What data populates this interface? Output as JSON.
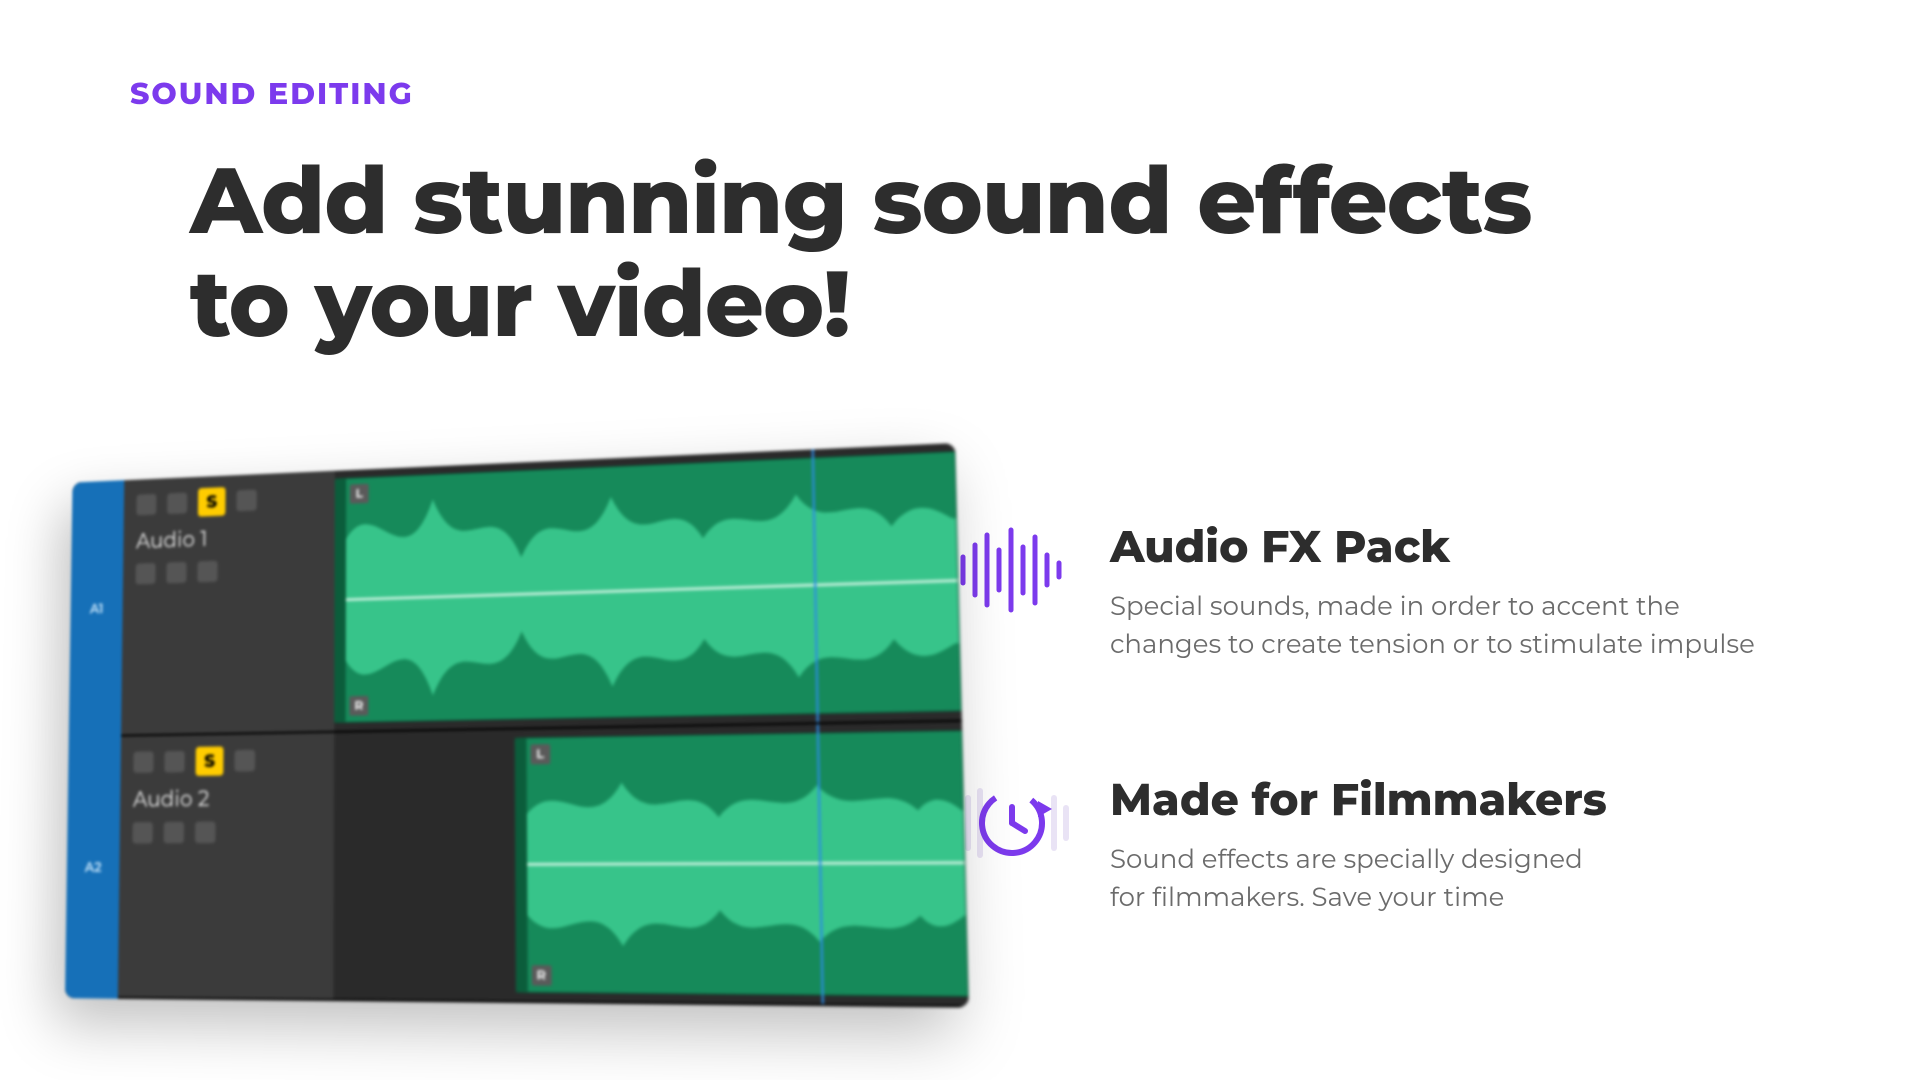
{
  "eyebrow": "SOUND EDITING",
  "headline": "Add stunning sound effects\nto your video!",
  "features": [
    {
      "icon": "waveform-icon",
      "title": "Audio FX Pack",
      "desc": "Special sounds, made in order to accent the\nchanges to create tension or to stimulate impulse"
    },
    {
      "icon": "clock-refresh-icon",
      "title": "Made for Filmmakers",
      "desc": "Sound effects are specially designed\nfor filmmakers. Save your time"
    }
  ],
  "screenshot": {
    "sidebar_labels": [
      "A1",
      "A2"
    ],
    "tracks": [
      {
        "name": "Audio 1",
        "solo_label": "S",
        "clip_offset_pct": 0
      },
      {
        "name": "Audio 2",
        "solo_label": "S",
        "clip_offset_pct": 30
      }
    ]
  },
  "colors": {
    "accent_purple": "#7c3aed",
    "text_dark": "#2d2d2d",
    "text_muted": "#6b6b6b",
    "waveform_green": "#37c48a"
  }
}
